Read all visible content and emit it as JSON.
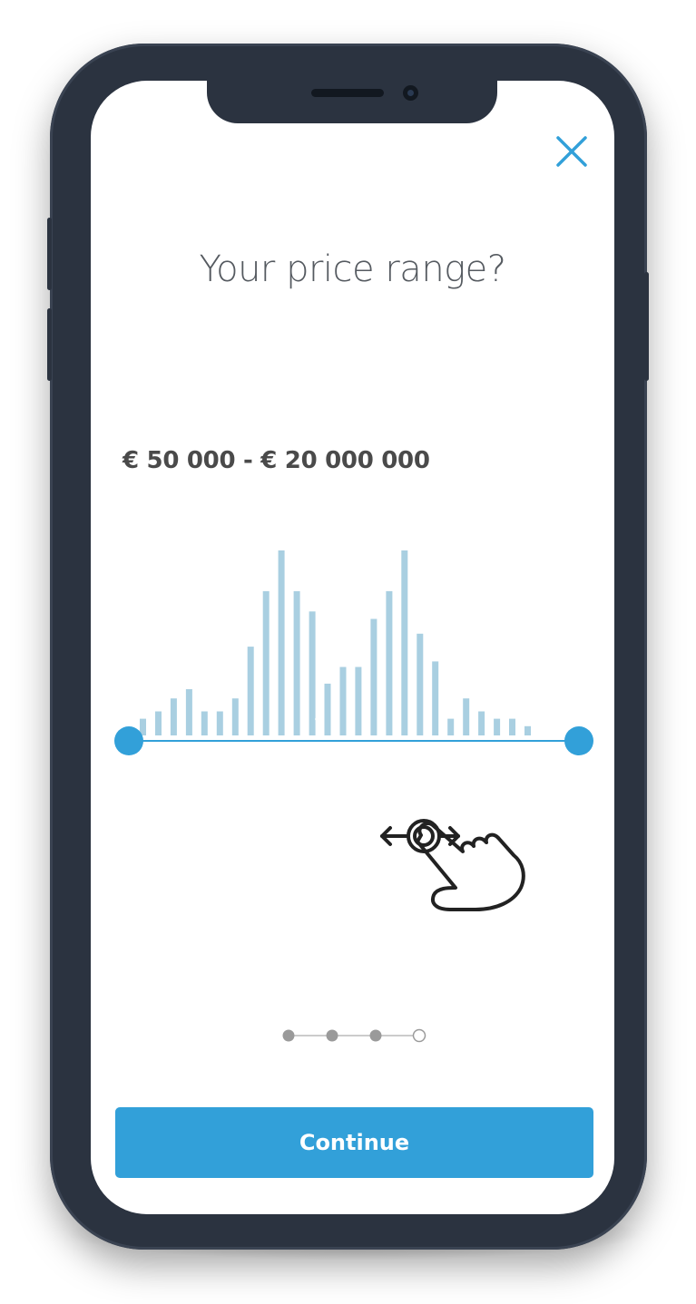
{
  "screen": {
    "title": "Your price range?",
    "range_label": "€ 50 000 - € 20 000 000",
    "continue_label": "Continue"
  },
  "colors": {
    "accent": "#32a0d9",
    "bar": "#a9cfe1",
    "frame": "#2b3340",
    "dot_done": "#9a9a9a"
  },
  "icons": {
    "close": "close-icon",
    "gesture": "swipe-hand-icon"
  },
  "slider": {
    "min_selected": 0,
    "max_selected": 1
  },
  "histogram_levels": [
    0.09,
    0.13,
    0.2,
    0.25,
    0.13,
    0.13,
    0.2,
    0.48,
    0.78,
    1.0,
    0.78,
    0.67,
    0.28,
    0.37,
    0.37,
    0.63,
    0.78,
    1.0,
    0.55,
    0.4,
    0.09,
    0.2,
    0.13,
    0.09,
    0.09,
    0.05
  ],
  "progress": {
    "total_steps": 4,
    "completed_steps": 3
  }
}
